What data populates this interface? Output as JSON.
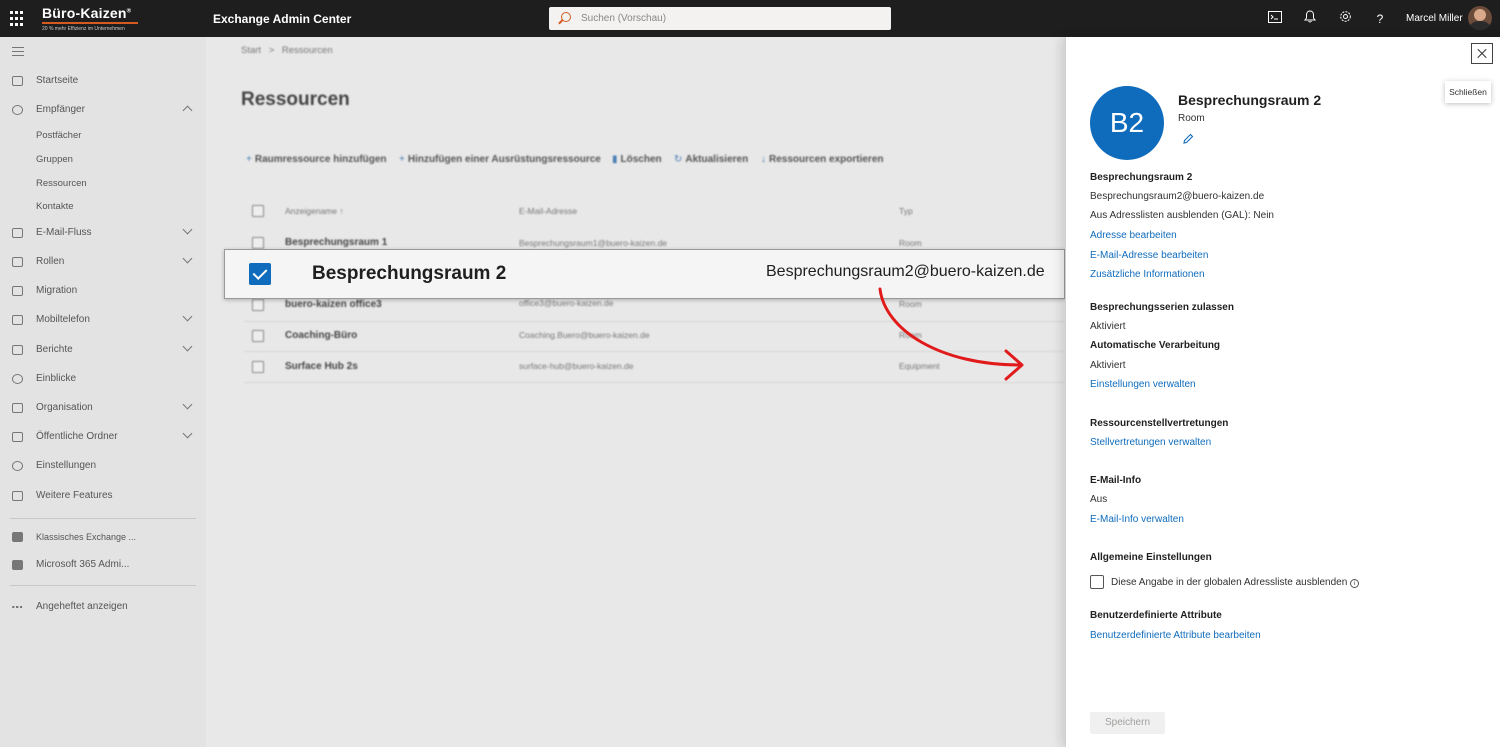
{
  "header": {
    "brand_name": "Büro-Kaizen",
    "brand_mark": "®",
    "brand_tagline": "20 % mehr Effizienz im Unternehmen",
    "app_title": "Exchange Admin Center",
    "search_placeholder": "Suchen (Vorschau)",
    "help_label": "?",
    "user_name": "Marcel Miller"
  },
  "sidebar": {
    "items": [
      {
        "label": "Startseite"
      },
      {
        "label": "Empfänger"
      },
      {
        "label": "E-Mail-Fluss"
      },
      {
        "label": "Rollen"
      },
      {
        "label": "Migration"
      },
      {
        "label": "Mobiltelefon"
      },
      {
        "label": "Berichte"
      },
      {
        "label": "Einblicke"
      },
      {
        "label": "Organisation"
      },
      {
        "label": "Öffentliche Ordner"
      },
      {
        "label": "Einstellungen"
      },
      {
        "label": "Weitere Features"
      },
      {
        "label": "Klassisches Exchange ..."
      },
      {
        "label": "Microsoft 365 Admi..."
      },
      {
        "label": "Angeheftet anzeigen"
      }
    ],
    "recipients_sub": [
      "Postfächer",
      "Gruppen",
      "Ressourcen",
      "Kontakte"
    ]
  },
  "main": {
    "breadcrumb_start": "Start",
    "breadcrumb_sep": ">",
    "breadcrumb_current": "Ressourcen",
    "title": "Ressourcen",
    "toolbar": [
      "Raumressource hinzufügen",
      "Hinzufügen einer Ausrüstungsressource",
      "Löschen",
      "Aktualisieren",
      "Ressourcen exportieren"
    ],
    "columns": {
      "name": "Anzeigename ↑",
      "email": "E-Mail-Adresse",
      "type": "Typ"
    },
    "rows": [
      {
        "name": "Besprechungsraum 1",
        "email": "Besprechungsraum1@buero-kaizen.de",
        "type": "Room"
      },
      {
        "name": "buero-kaizen office3",
        "email": "office3@buero-kaizen.de",
        "type": "Room"
      },
      {
        "name": "Coaching-Büro",
        "email": "Coaching.Buero@buero-kaizen.de",
        "type": "Room"
      },
      {
        "name": "Surface Hub 2s",
        "email": "surface-hub@buero-kaizen.de",
        "type": "Equipment"
      }
    ],
    "selected_row": {
      "name": "Besprechungsraum 2",
      "email": "Besprechungsraum2@buero-kaizen.de"
    }
  },
  "panel": {
    "close_tooltip": "Schließen",
    "avatar_initials": "B2",
    "title": "Besprechungsraum 2",
    "subtitle": "Room",
    "name": "Besprechungsraum 2",
    "email": "Besprechungsraum2@buero-kaizen.de",
    "hide_gal": "Aus Adresslisten ausblenden (GAL): Nein",
    "link_edit_address": "Adresse bearbeiten",
    "link_edit_email": "E-Mail-Adresse bearbeiten",
    "link_more_info": "Zusätzliche Informationen",
    "h_series": "Besprechungsserien zulassen",
    "series_value": "Aktiviert",
    "h_auto": "Automatische Verarbeitung",
    "auto_value": "Aktiviert",
    "link_manage_settings": "Einstellungen verwalten",
    "h_delegates": "Ressourcenstellvertretungen",
    "link_manage_delegates": "Stellvertretungen verwalten",
    "h_mailtip": "E-Mail-Info",
    "mailtip_value": "Aus",
    "link_manage_mailtip": "E-Mail-Info verwalten",
    "h_general": "Allgemeine Einstellungen",
    "checkbox_hide": "Diese Angabe in der globalen Adressliste ausblenden",
    "info_glyph": "i",
    "h_custom": "Benutzerdefinierte Attribute",
    "link_custom": "Benutzerdefinierte Attribute bearbeiten",
    "save_label": "Speichern"
  },
  "colors": {
    "accent": "#0f6cbd",
    "brand_orange": "#d65a1f",
    "arrow": "#e11b1b"
  }
}
